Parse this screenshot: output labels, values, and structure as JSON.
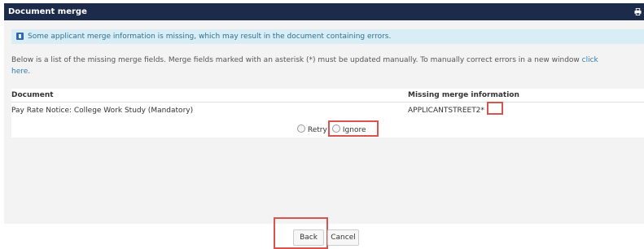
{
  "window": {
    "title": "Document merge",
    "print_icon": "print-icon"
  },
  "alert": {
    "icon": "info-icon",
    "text": "Some applicant merge information is missing, which may result in the document containing errors."
  },
  "description": {
    "text": "Below is a list of the missing merge fields. Merge fields marked with an asterisk (*) must be updated manually. To manually correct errors in a new window ",
    "link": "click here",
    "end": "."
  },
  "table": {
    "headers": [
      "Document",
      "Missing merge information"
    ],
    "rows": [
      {
        "document": "Pay Rate Notice: College Work Study (Mandatory)",
        "missing": "APPLICANTSTREET2*"
      }
    ],
    "options": {
      "retry": "Retry",
      "ignore": "Ignore"
    }
  },
  "footer": {
    "back": "Back",
    "cancel": "Cancel"
  },
  "colors": {
    "titlebar": "#1c2b4a",
    "alert_bg": "#d9edf7",
    "alert_text": "#31708f",
    "highlight": "#d9534f"
  }
}
